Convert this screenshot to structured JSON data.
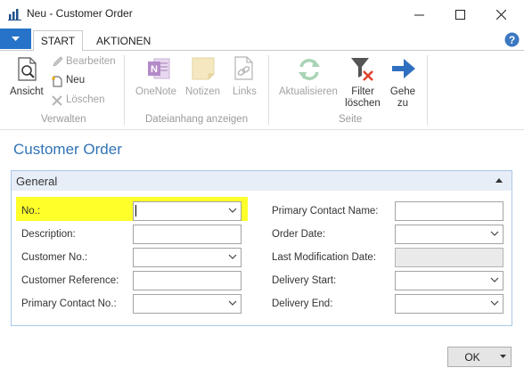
{
  "window": {
    "title": "Neu - Customer Order"
  },
  "ribbon": {
    "tabs": [
      {
        "label": "START",
        "active": true
      },
      {
        "label": "AKTIONEN",
        "active": false
      }
    ],
    "groups": {
      "verwalten": {
        "label": "Verwalten",
        "ansicht": "Ansicht",
        "bearbeiten": "Bearbeiten",
        "neu": "Neu",
        "loeschen": "Löschen"
      },
      "dateianhang": {
        "label": "Dateianhang anzeigen",
        "onenote": "OneNote",
        "notizen": "Notizen",
        "links": "Links"
      },
      "seite": {
        "label": "Seite",
        "aktualisieren": "Aktualisieren",
        "filter_line1": "Filter",
        "filter_line2": "löschen",
        "gehe_line1": "Gehe",
        "gehe_line2": "zu"
      }
    }
  },
  "page": {
    "title": "Customer Order",
    "fasttab": {
      "title": "General"
    },
    "fields_left": [
      {
        "label": "No.:",
        "value": ""
      },
      {
        "label": "Description:",
        "value": ""
      },
      {
        "label": "Customer No.:",
        "value": ""
      },
      {
        "label": "Customer Reference:",
        "value": ""
      },
      {
        "label": "Primary Contact No.:",
        "value": ""
      }
    ],
    "fields_right": [
      {
        "label": "Primary Contact Name:",
        "value": ""
      },
      {
        "label": "Order Date:",
        "value": ""
      },
      {
        "label": "Last Modification Date:",
        "value": ""
      },
      {
        "label": "Delivery Start:",
        "value": ""
      },
      {
        "label": "Delivery End:",
        "value": ""
      }
    ]
  },
  "footer": {
    "ok_label": "OK"
  },
  "colors": {
    "accent": "#2773c9",
    "page_title": "#2f73b6",
    "highlight": "#ffff2a",
    "fasttab_border": "#a9c7e8"
  }
}
